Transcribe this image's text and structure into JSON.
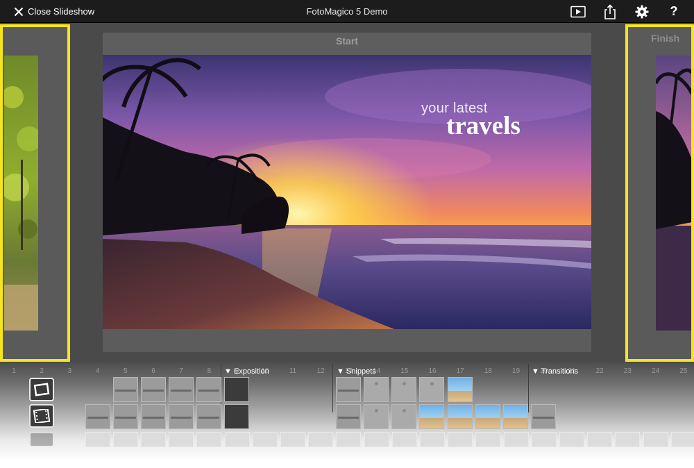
{
  "topbar": {
    "close_label": "Close Slideshow",
    "title": "FotoMagico 5 Demo",
    "help_glyph": "?"
  },
  "stage": {
    "start_label": "Start",
    "finish_label": "Finish",
    "caption_small": "your latest",
    "caption_big": "travels",
    "highlight_color": "#f6e51b"
  },
  "timeline": {
    "numbers": [
      "1",
      "2",
      "3",
      "4",
      "5",
      "6",
      "7",
      "8",
      "9",
      "10",
      "11",
      "12",
      "13",
      "14",
      "15",
      "16",
      "17",
      "18",
      "19",
      "20",
      "21",
      "22",
      "23",
      "24",
      "25"
    ],
    "sections": {
      "exposition": "▼ Exposition",
      "snippets": "▼ Snippets",
      "transitions": "▼ Transitions"
    }
  }
}
